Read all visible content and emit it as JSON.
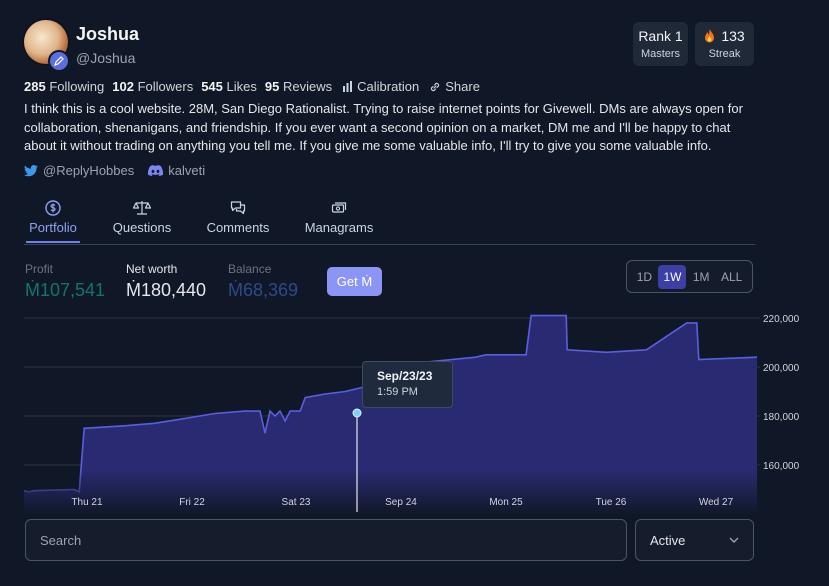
{
  "profile": {
    "name": "Joshua",
    "handle": "@Joshua",
    "bio": "I think this is a cool website. 28M, San Diego Rationalist. Trying to raise internet points for Givewell. DMs are always open for collaboration, shenanigans, and friendship. If you ever want a second opinion on a market, DM me and I'll be happy to chat about it without trading on anything you tell me. If you give me some valuable info, I'll try to give you some valuable info."
  },
  "badges": {
    "rank_value": "Rank 1",
    "rank_label": "Masters",
    "streak_value": "133",
    "streak_label": "Streak"
  },
  "stats": {
    "following_count": "285",
    "following_label": "Following",
    "followers_count": "102",
    "followers_label": "Followers",
    "likes_count": "545",
    "likes_label": "Likes",
    "reviews_count": "95",
    "reviews_label": "Reviews",
    "calibration_label": "Calibration",
    "share_label": "Share"
  },
  "socials": {
    "twitter": "@ReplyHobbes",
    "discord": "kalveti"
  },
  "tabs": [
    {
      "label": "Portfolio",
      "icon": "currency-circle-icon",
      "active": true
    },
    {
      "label": "Questions",
      "icon": "scale-icon",
      "active": false
    },
    {
      "label": "Comments",
      "icon": "chat-icon",
      "active": false
    },
    {
      "label": "Managrams",
      "icon": "cash-icon",
      "active": false
    }
  ],
  "metrics": {
    "profit_label": "Profit",
    "profit_value": "Ṁ107,541",
    "networth_label": "Net worth",
    "networth_value": "Ṁ180,440",
    "balance_label": "Balance",
    "balance_value": "Ṁ68,369",
    "get_label": "Get Ṁ"
  },
  "range": {
    "options": [
      "1D",
      "1W",
      "1M",
      "ALL"
    ],
    "selected": "1W"
  },
  "colors": {
    "accent": "#6f7ff0",
    "profit": "#0f766e",
    "balance": "#2d4a8a",
    "chart_fill": "#2a2a72",
    "chart_line": "#5b5ee0"
  },
  "chart_data": {
    "type": "area",
    "x_ticks": [
      "Thu 21",
      "Fri 22",
      "Sat 23",
      "Sep 24",
      "Mon 25",
      "Tue 26",
      "Wed 27"
    ],
    "y_ticks": [
      "220,000",
      "200,000",
      "180,000",
      "160,000"
    ],
    "ylim": [
      143000,
      225000
    ],
    "series": [
      {
        "t": [
          0,
          0.05,
          0.1,
          0.5,
          0.55,
          0.6,
          1.0,
          1.3,
          1.6,
          1.9,
          2.2,
          2.35,
          2.4,
          2.45,
          2.5,
          2.55,
          2.6,
          2.65,
          2.75,
          2.8,
          3.0,
          3.2,
          3.4,
          3.6,
          3.8,
          3.95,
          4.0,
          4.5,
          4.6,
          5.0,
          5.05,
          5.4,
          5.41,
          5.8,
          6.2,
          6.6,
          6.7,
          6.72,
          7.3
        ],
        "values": [
          149500,
          149000,
          149500,
          150000,
          149000,
          175000,
          176000,
          177000,
          179000,
          181000,
          182000,
          182000,
          173000,
          182000,
          180000,
          182000,
          178000,
          182000,
          182000,
          187500,
          189000,
          190000,
          192000,
          197000,
          198500,
          198000,
          202000,
          204000,
          205000,
          205000,
          221000,
          221000,
          207000,
          206000,
          207000,
          218000,
          218000,
          203000,
          204000
        ]
      }
    ]
  },
  "tooltip": {
    "date": "Sep/23/23",
    "time": "1:59 PM"
  },
  "search": {
    "placeholder": "Search"
  },
  "filter": {
    "selected": "Active"
  }
}
